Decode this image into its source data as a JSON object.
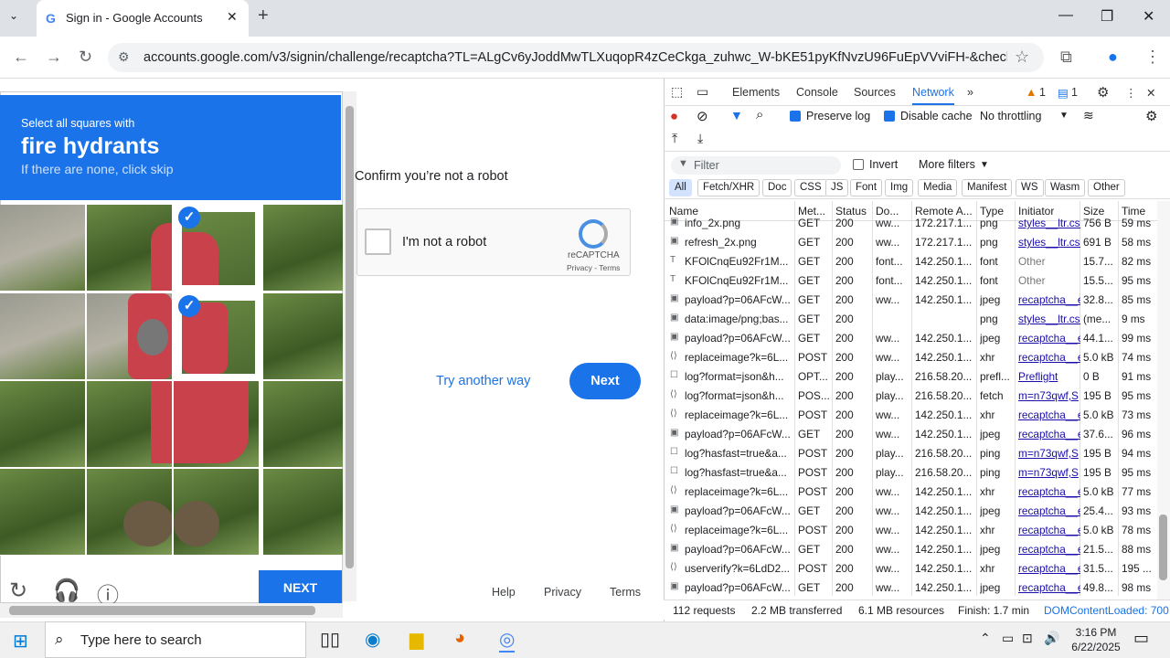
{
  "browser": {
    "tab_title": "Sign in - Google Accounts",
    "url": "accounts.google.com/v3/signin/challenge/recaptcha?TL=ALgCv6yJoddMwTLXuqopR4zCeCkga_zuhwc_W-bKE51pyKfNvzU96FuEpVVviFH-&checkConn...",
    "new_tab": "+"
  },
  "captcha": {
    "line1": "Select all squares with",
    "line2": "fire hydrants",
    "line3": "If there are none, click skip",
    "next_label": "NEXT"
  },
  "page": {
    "confirm_text": "Confirm you’re not a robot",
    "checkbox_label": "I'm not a robot",
    "recaptcha_name": "reCAPTCHA",
    "recaptcha_links": "Privacy - Terms",
    "try_another": "Try another way",
    "next": "Next",
    "footer": {
      "help": "Help",
      "privacy": "Privacy",
      "terms": "Terms"
    }
  },
  "devtools": {
    "tabs": [
      "Elements",
      "Console",
      "Sources",
      "Network"
    ],
    "active_tab": "Network",
    "warnings": "1",
    "messages": "1",
    "preserve_log": "Preserve log",
    "disable_cache": "Disable cache",
    "throttling": "No throttling",
    "filter_placeholder": "Filter",
    "invert": "Invert",
    "more_filters": "More filters",
    "types": [
      "All",
      "Fetch/XHR",
      "Doc",
      "CSS",
      "JS",
      "Font",
      "Img",
      "Media",
      "Manifest",
      "WS",
      "Wasm",
      "Other"
    ],
    "columns": [
      "Name",
      "Met...",
      "Status",
      "Do...",
      "Remote A...",
      "Type",
      "Initiator",
      "Size",
      "Time"
    ],
    "rows": [
      {
        "name": "info_2x.png",
        "method": "GET",
        "status": "200",
        "domain": "ww...",
        "remote": "172.217.1...",
        "type": "png",
        "initiator": "styles__ltr.css",
        "size": "756 B",
        "time": "59 ms"
      },
      {
        "name": "refresh_2x.png",
        "method": "GET",
        "status": "200",
        "domain": "ww...",
        "remote": "172.217.1...",
        "type": "png",
        "initiator": "styles__ltr.css",
        "size": "691 B",
        "time": "58 ms"
      },
      {
        "name": "KFOlCnqEu92Fr1M...",
        "method": "GET",
        "status": "200",
        "domain": "font...",
        "remote": "142.250.1...",
        "type": "font",
        "initiator": "Other",
        "size": "15.7...",
        "time": "82 ms"
      },
      {
        "name": "KFOlCnqEu92Fr1M...",
        "method": "GET",
        "status": "200",
        "domain": "font...",
        "remote": "142.250.1...",
        "type": "font",
        "initiator": "Other",
        "size": "15.5...",
        "time": "95 ms"
      },
      {
        "name": "payload?p=06AFcW...",
        "method": "GET",
        "status": "200",
        "domain": "ww...",
        "remote": "142.250.1...",
        "type": "jpeg",
        "initiator": "recaptcha__e",
        "size": "32.8...",
        "time": "85 ms"
      },
      {
        "name": "data:image/png;bas...",
        "method": "GET",
        "status": "200",
        "domain": "",
        "remote": "",
        "type": "png",
        "initiator": "styles__ltr.css",
        "size": "(me...",
        "time": "9 ms"
      },
      {
        "name": "payload?p=06AFcW...",
        "method": "GET",
        "status": "200",
        "domain": "ww...",
        "remote": "142.250.1...",
        "type": "jpeg",
        "initiator": "recaptcha__e",
        "size": "44.1...",
        "time": "99 ms"
      },
      {
        "name": "replaceimage?k=6L...",
        "method": "POST",
        "status": "200",
        "domain": "ww...",
        "remote": "142.250.1...",
        "type": "xhr",
        "initiator": "recaptcha__e",
        "size": "5.0 kB",
        "time": "74 ms"
      },
      {
        "name": "log?format=json&h...",
        "method": "OPT...",
        "status": "200",
        "domain": "play...",
        "remote": "216.58.20...",
        "type": "prefl...",
        "initiator": "Preflight",
        "size": "0 B",
        "time": "91 ms"
      },
      {
        "name": "log?format=json&h...",
        "method": "POS...",
        "status": "200",
        "domain": "play...",
        "remote": "216.58.20...",
        "type": "fetch",
        "initiator": "m=n73qwf,S",
        "size": "195 B",
        "time": "95 ms"
      },
      {
        "name": "replaceimage?k=6L...",
        "method": "POST",
        "status": "200",
        "domain": "ww...",
        "remote": "142.250.1...",
        "type": "xhr",
        "initiator": "recaptcha__e",
        "size": "5.0 kB",
        "time": "73 ms"
      },
      {
        "name": "payload?p=06AFcW...",
        "method": "GET",
        "status": "200",
        "domain": "ww...",
        "remote": "142.250.1...",
        "type": "jpeg",
        "initiator": "recaptcha__e",
        "size": "37.6...",
        "time": "96 ms"
      },
      {
        "name": "log?hasfast=true&a...",
        "method": "POST",
        "status": "200",
        "domain": "play...",
        "remote": "216.58.20...",
        "type": "ping",
        "initiator": "m=n73qwf,S",
        "size": "195 B",
        "time": "94 ms"
      },
      {
        "name": "log?hasfast=true&a...",
        "method": "POST",
        "status": "200",
        "domain": "play...",
        "remote": "216.58.20...",
        "type": "ping",
        "initiator": "m=n73qwf,S",
        "size": "195 B",
        "time": "95 ms"
      },
      {
        "name": "replaceimage?k=6L...",
        "method": "POST",
        "status": "200",
        "domain": "ww...",
        "remote": "142.250.1...",
        "type": "xhr",
        "initiator": "recaptcha__e",
        "size": "5.0 kB",
        "time": "77 ms"
      },
      {
        "name": "payload?p=06AFcW...",
        "method": "GET",
        "status": "200",
        "domain": "ww...",
        "remote": "142.250.1...",
        "type": "jpeg",
        "initiator": "recaptcha__e",
        "size": "25.4...",
        "time": "93 ms"
      },
      {
        "name": "replaceimage?k=6L...",
        "method": "POST",
        "status": "200",
        "domain": "ww...",
        "remote": "142.250.1...",
        "type": "xhr",
        "initiator": "recaptcha__e",
        "size": "5.0 kB",
        "time": "78 ms"
      },
      {
        "name": "payload?p=06AFcW...",
        "method": "GET",
        "status": "200",
        "domain": "ww...",
        "remote": "142.250.1...",
        "type": "jpeg",
        "initiator": "recaptcha__e",
        "size": "21.5...",
        "time": "88 ms"
      },
      {
        "name": "userverify?k=6LdD2...",
        "method": "POST",
        "status": "200",
        "domain": "ww...",
        "remote": "142.250.1...",
        "type": "xhr",
        "initiator": "recaptcha__e",
        "size": "31.5...",
        "time": "195 ..."
      },
      {
        "name": "payload?p=06AFcW...",
        "method": "GET",
        "status": "200",
        "domain": "ww...",
        "remote": "142.250.1...",
        "type": "jpeg",
        "initiator": "recaptcha__e",
        "size": "49.8...",
        "time": "98 ms"
      }
    ],
    "status": {
      "requests": "112 requests",
      "transferred": "2.2 MB transferred",
      "resources": "6.1 MB resources",
      "finish": "Finish: 1.7 min",
      "dcl": "DOMContentLoaded: 700"
    }
  },
  "taskbar": {
    "search_placeholder": "Type here to search",
    "time": "3:16 PM",
    "date": "6/22/2025"
  }
}
